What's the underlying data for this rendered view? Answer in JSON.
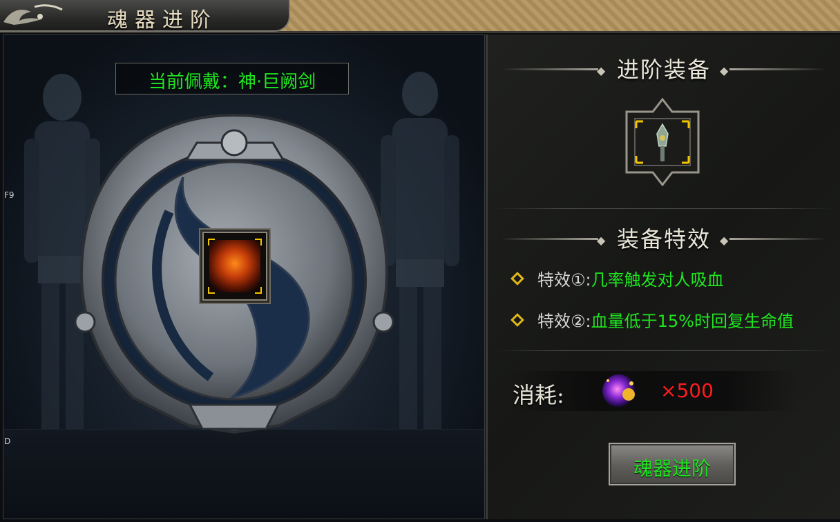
{
  "window": {
    "title": "魂器进阶"
  },
  "left_panel": {
    "current_wearing": "当前佩戴：神·巨阙剑",
    "side_labels": [
      "F9",
      "D"
    ]
  },
  "right_panel": {
    "equip_section_title": "进阶装备",
    "effects_section_title": "装备特效",
    "effects": [
      {
        "label": "特效①:",
        "text": "几率触发对人吸血"
      },
      {
        "label": "特效②:",
        "text": "血量低于15%时回复生命值"
      }
    ],
    "consume_label": "消耗:",
    "consume_qty": "×500",
    "action_button": "魂器进阶"
  },
  "colors": {
    "accent_green": "#1ee61e",
    "qty_red": "#ff1c1c",
    "diamond_gold": "#e0b81a"
  },
  "icons": [
    "scroll-ornament-icon",
    "emblem-shield-icon",
    "flame-figure-icon",
    "weapon-icon",
    "soul-orb-icon",
    "diamond-bullet-icon"
  ]
}
